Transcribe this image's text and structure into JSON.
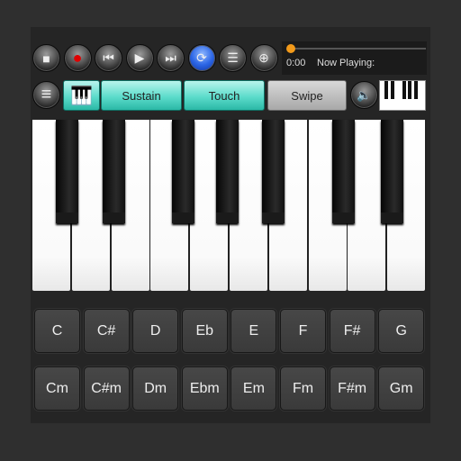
{
  "transport": {
    "buttons": [
      {
        "name": "stop-button",
        "icon": "stop-icon",
        "glyph": "■"
      },
      {
        "name": "record-button",
        "icon": "record-icon",
        "glyph": "●"
      },
      {
        "name": "previous-button",
        "icon": "skip-back-icon",
        "glyph": "⏮"
      },
      {
        "name": "play-button",
        "icon": "play-icon",
        "glyph": "▶"
      },
      {
        "name": "next-button",
        "icon": "skip-forward-icon",
        "glyph": "⏭"
      },
      {
        "name": "repeat-button",
        "icon": "repeat-icon",
        "glyph": "⟳"
      },
      {
        "name": "playlist-button",
        "icon": "playlist-icon",
        "glyph": "☰"
      },
      {
        "name": "globe-button",
        "icon": "globe-icon",
        "glyph": "⊕"
      }
    ]
  },
  "player": {
    "time": "0:00",
    "now_playing": "Now Playing:",
    "progress": 0
  },
  "toolbar": {
    "menu_glyph": "≡",
    "sustain": "Sustain",
    "touch": "Touch",
    "swipe": "Swipe",
    "speaker_glyph": "🔈",
    "piano_glyph": "🎹"
  },
  "colors": {
    "accent": "#5cdccb",
    "record": "#e00000",
    "repeat": "#2c66e6",
    "slider": "#f29a1a"
  },
  "chords": {
    "major": [
      "C",
      "C#",
      "D",
      "Eb",
      "E",
      "F",
      "F#",
      "G"
    ],
    "minor": [
      "Cm",
      "C#m",
      "Dm",
      "Ebm",
      "Em",
      "Fm",
      "F#m",
      "Gm"
    ]
  }
}
